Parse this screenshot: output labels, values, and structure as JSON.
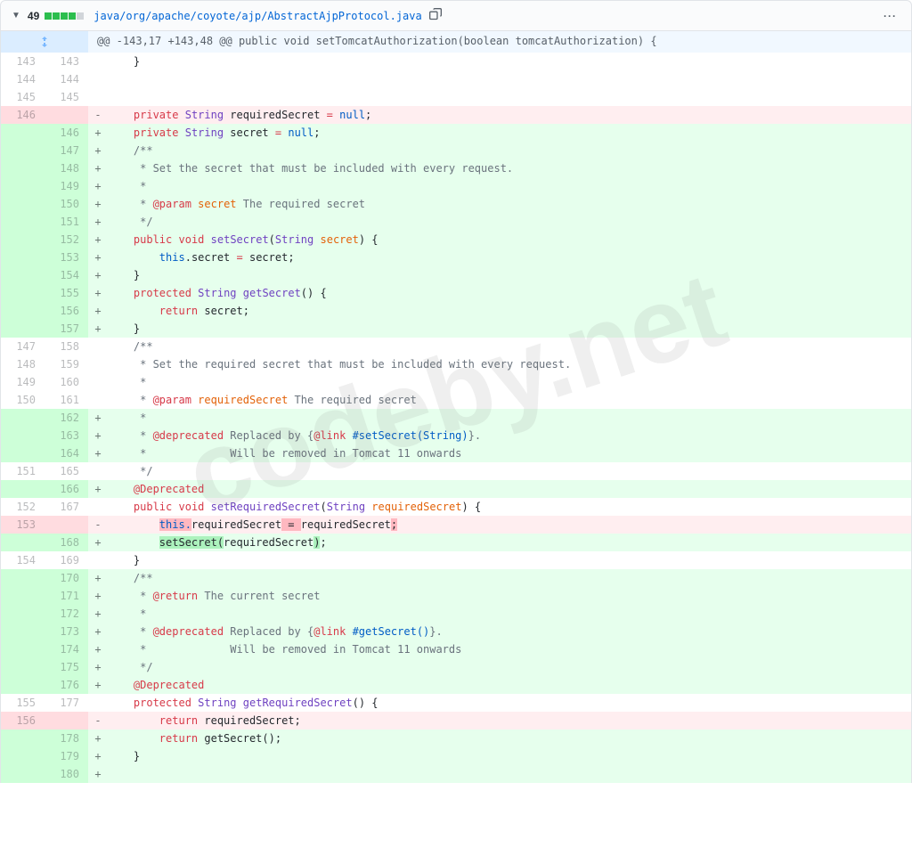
{
  "file": {
    "changes_count": "49",
    "diffstat_added": 4,
    "diffstat_neutral": 1,
    "path": "java/org/apache/coyote/ajp/AbstractAjpProtocol.java"
  },
  "hunk_header": "@@ -143,17 +143,48 @@ public void setTomcatAuthorization(boolean tomcatAuthorization) {",
  "watermark": "codeby.net",
  "lines": [
    {
      "type": "ctx",
      "old": "143",
      "new": "143",
      "tokens": [
        {
          "t": "    }",
          "c": ""
        }
      ]
    },
    {
      "type": "ctx",
      "old": "144",
      "new": "144",
      "tokens": [
        {
          "t": "",
          "c": ""
        }
      ]
    },
    {
      "type": "ctx",
      "old": "145",
      "new": "145",
      "tokens": [
        {
          "t": "",
          "c": ""
        }
      ]
    },
    {
      "type": "del",
      "old": "146",
      "new": "",
      "tokens": [
        {
          "t": "    ",
          "c": ""
        },
        {
          "t": "private",
          "c": "k"
        },
        {
          "t": " ",
          "c": ""
        },
        {
          "t": "String",
          "c": "t"
        },
        {
          "t": " requiredSecret ",
          "c": ""
        },
        {
          "t": "=",
          "c": "k"
        },
        {
          "t": " ",
          "c": ""
        },
        {
          "t": "null",
          "c": "n"
        },
        {
          "t": ";",
          "c": ""
        }
      ]
    },
    {
      "type": "add",
      "old": "",
      "new": "146",
      "tokens": [
        {
          "t": "    ",
          "c": ""
        },
        {
          "t": "private",
          "c": "k"
        },
        {
          "t": " ",
          "c": ""
        },
        {
          "t": "String",
          "c": "t"
        },
        {
          "t": " secret ",
          "c": ""
        },
        {
          "t": "=",
          "c": "k"
        },
        {
          "t": " ",
          "c": ""
        },
        {
          "t": "null",
          "c": "n"
        },
        {
          "t": ";",
          "c": ""
        }
      ]
    },
    {
      "type": "add",
      "old": "",
      "new": "147",
      "tokens": [
        {
          "t": "    ",
          "c": ""
        },
        {
          "t": "/**",
          "c": "c"
        }
      ]
    },
    {
      "type": "add",
      "old": "",
      "new": "148",
      "tokens": [
        {
          "t": "     * Set the secret that must be included with every request.",
          "c": "c"
        }
      ]
    },
    {
      "type": "add",
      "old": "",
      "new": "149",
      "tokens": [
        {
          "t": "     *",
          "c": "c"
        }
      ]
    },
    {
      "type": "add",
      "old": "",
      "new": "150",
      "tokens": [
        {
          "t": "     * ",
          "c": "c"
        },
        {
          "t": "@param",
          "c": "k"
        },
        {
          "t": " ",
          "c": "c"
        },
        {
          "t": "secret",
          "c": "v"
        },
        {
          "t": " The required secret",
          "c": "c"
        }
      ]
    },
    {
      "type": "add",
      "old": "",
      "new": "151",
      "tokens": [
        {
          "t": "     */",
          "c": "c"
        }
      ]
    },
    {
      "type": "add",
      "old": "",
      "new": "152",
      "tokens": [
        {
          "t": "    ",
          "c": ""
        },
        {
          "t": "public",
          "c": "k"
        },
        {
          "t": " ",
          "c": ""
        },
        {
          "t": "void",
          "c": "k"
        },
        {
          "t": " ",
          "c": ""
        },
        {
          "t": "setSecret",
          "c": "t"
        },
        {
          "t": "(",
          "c": ""
        },
        {
          "t": "String",
          "c": "t"
        },
        {
          "t": " ",
          "c": ""
        },
        {
          "t": "secret",
          "c": "v"
        },
        {
          "t": ") {",
          "c": ""
        }
      ]
    },
    {
      "type": "add",
      "old": "",
      "new": "153",
      "tokens": [
        {
          "t": "        ",
          "c": ""
        },
        {
          "t": "this",
          "c": "n"
        },
        {
          "t": ".",
          "c": ""
        },
        {
          "t": "secret ",
          "c": ""
        },
        {
          "t": "=",
          "c": "k"
        },
        {
          "t": " secret;",
          "c": ""
        }
      ]
    },
    {
      "type": "add",
      "old": "",
      "new": "154",
      "tokens": [
        {
          "t": "    }",
          "c": ""
        }
      ]
    },
    {
      "type": "add",
      "old": "",
      "new": "155",
      "tokens": [
        {
          "t": "    ",
          "c": ""
        },
        {
          "t": "protected",
          "c": "k"
        },
        {
          "t": " ",
          "c": ""
        },
        {
          "t": "String",
          "c": "t"
        },
        {
          "t": " ",
          "c": ""
        },
        {
          "t": "getSecret",
          "c": "t"
        },
        {
          "t": "() {",
          "c": ""
        }
      ]
    },
    {
      "type": "add",
      "old": "",
      "new": "156",
      "tokens": [
        {
          "t": "        ",
          "c": ""
        },
        {
          "t": "return",
          "c": "k"
        },
        {
          "t": " secret;",
          "c": ""
        }
      ]
    },
    {
      "type": "add",
      "old": "",
      "new": "157",
      "tokens": [
        {
          "t": "    }",
          "c": ""
        }
      ]
    },
    {
      "type": "ctx",
      "old": "147",
      "new": "158",
      "tokens": [
        {
          "t": "    ",
          "c": ""
        },
        {
          "t": "/**",
          "c": "c"
        }
      ]
    },
    {
      "type": "ctx",
      "old": "148",
      "new": "159",
      "tokens": [
        {
          "t": "     * Set the required secret that must be included with every request.",
          "c": "c"
        }
      ]
    },
    {
      "type": "ctx",
      "old": "149",
      "new": "160",
      "tokens": [
        {
          "t": "     *",
          "c": "c"
        }
      ]
    },
    {
      "type": "ctx",
      "old": "150",
      "new": "161",
      "tokens": [
        {
          "t": "     * ",
          "c": "c"
        },
        {
          "t": "@param",
          "c": "k"
        },
        {
          "t": " ",
          "c": "c"
        },
        {
          "t": "requiredSecret",
          "c": "v"
        },
        {
          "t": " The required secret",
          "c": "c"
        }
      ]
    },
    {
      "type": "add",
      "old": "",
      "new": "162",
      "tokens": [
        {
          "t": "     *",
          "c": "c"
        }
      ]
    },
    {
      "type": "add",
      "old": "",
      "new": "163",
      "tokens": [
        {
          "t": "     * ",
          "c": "c"
        },
        {
          "t": "@deprecated",
          "c": "k"
        },
        {
          "t": " Replaced by {",
          "c": "c"
        },
        {
          "t": "@link",
          "c": "k"
        },
        {
          "t": " ",
          "c": "c"
        },
        {
          "t": "#setSecret(String)",
          "c": "n"
        },
        {
          "t": "}.",
          "c": "c"
        }
      ]
    },
    {
      "type": "add",
      "old": "",
      "new": "164",
      "tokens": [
        {
          "t": "     *             Will be removed in Tomcat 11 onwards",
          "c": "c"
        }
      ]
    },
    {
      "type": "ctx",
      "old": "151",
      "new": "165",
      "tokens": [
        {
          "t": "     */",
          "c": "c"
        }
      ]
    },
    {
      "type": "add",
      "old": "",
      "new": "166",
      "tokens": [
        {
          "t": "    ",
          "c": ""
        },
        {
          "t": "@Deprecated",
          "c": "k"
        }
      ]
    },
    {
      "type": "ctx",
      "old": "152",
      "new": "167",
      "tokens": [
        {
          "t": "    ",
          "c": ""
        },
        {
          "t": "public",
          "c": "k"
        },
        {
          "t": " ",
          "c": ""
        },
        {
          "t": "void",
          "c": "k"
        },
        {
          "t": " ",
          "c": ""
        },
        {
          "t": "setRequiredSecret",
          "c": "t"
        },
        {
          "t": "(",
          "c": ""
        },
        {
          "t": "String",
          "c": "t"
        },
        {
          "t": " ",
          "c": ""
        },
        {
          "t": "requiredSecret",
          "c": "v"
        },
        {
          "t": ") {",
          "c": ""
        }
      ]
    },
    {
      "type": "del",
      "old": "153",
      "new": "",
      "tokens": [
        {
          "t": "        ",
          "c": ""
        },
        {
          "t": "this.",
          "c": "hl-del n"
        },
        {
          "t": "requiredSecret",
          "c": ""
        },
        {
          "t": " = ",
          "c": "hl-del"
        },
        {
          "t": "requiredSecret",
          "c": ""
        },
        {
          "t": ";",
          "c": "hl-del"
        }
      ]
    },
    {
      "type": "add",
      "old": "",
      "new": "168",
      "tokens": [
        {
          "t": "        ",
          "c": ""
        },
        {
          "t": "setSecret(",
          "c": "hl-add"
        },
        {
          "t": "requiredSecret",
          "c": ""
        },
        {
          "t": ")",
          "c": "hl-add"
        },
        {
          "t": ";",
          "c": ""
        }
      ]
    },
    {
      "type": "ctx",
      "old": "154",
      "new": "169",
      "tokens": [
        {
          "t": "    }",
          "c": ""
        }
      ]
    },
    {
      "type": "add",
      "old": "",
      "new": "170",
      "tokens": [
        {
          "t": "    ",
          "c": ""
        },
        {
          "t": "/**",
          "c": "c"
        }
      ]
    },
    {
      "type": "add",
      "old": "",
      "new": "171",
      "tokens": [
        {
          "t": "     * ",
          "c": "c"
        },
        {
          "t": "@return",
          "c": "k"
        },
        {
          "t": " The current secret",
          "c": "c"
        }
      ]
    },
    {
      "type": "add",
      "old": "",
      "new": "172",
      "tokens": [
        {
          "t": "     *",
          "c": "c"
        }
      ]
    },
    {
      "type": "add",
      "old": "",
      "new": "173",
      "tokens": [
        {
          "t": "     * ",
          "c": "c"
        },
        {
          "t": "@deprecated",
          "c": "k"
        },
        {
          "t": " Replaced by {",
          "c": "c"
        },
        {
          "t": "@link",
          "c": "k"
        },
        {
          "t": " ",
          "c": "c"
        },
        {
          "t": "#getSecret()",
          "c": "n"
        },
        {
          "t": "}.",
          "c": "c"
        }
      ]
    },
    {
      "type": "add",
      "old": "",
      "new": "174",
      "tokens": [
        {
          "t": "     *             Will be removed in Tomcat 11 onwards",
          "c": "c"
        }
      ]
    },
    {
      "type": "add",
      "old": "",
      "new": "175",
      "tokens": [
        {
          "t": "     */",
          "c": "c"
        }
      ]
    },
    {
      "type": "add",
      "old": "",
      "new": "176",
      "tokens": [
        {
          "t": "    ",
          "c": ""
        },
        {
          "t": "@Deprecated",
          "c": "k"
        }
      ]
    },
    {
      "type": "ctx",
      "old": "155",
      "new": "177",
      "tokens": [
        {
          "t": "    ",
          "c": ""
        },
        {
          "t": "protected",
          "c": "k"
        },
        {
          "t": " ",
          "c": ""
        },
        {
          "t": "String",
          "c": "t"
        },
        {
          "t": " ",
          "c": ""
        },
        {
          "t": "getRequiredSecret",
          "c": "t"
        },
        {
          "t": "() {",
          "c": ""
        }
      ]
    },
    {
      "type": "del",
      "old": "156",
      "new": "",
      "tokens": [
        {
          "t": "        ",
          "c": ""
        },
        {
          "t": "return",
          "c": "k"
        },
        {
          "t": " requiredSecret;",
          "c": ""
        }
      ]
    },
    {
      "type": "add",
      "old": "",
      "new": "178",
      "tokens": [
        {
          "t": "        ",
          "c": ""
        },
        {
          "t": "return",
          "c": "k"
        },
        {
          "t": " getSecret();",
          "c": ""
        }
      ]
    },
    {
      "type": "add",
      "old": "",
      "new": "179",
      "tokens": [
        {
          "t": "    }",
          "c": ""
        }
      ]
    },
    {
      "type": "add",
      "old": "",
      "new": "180",
      "tokens": [
        {
          "t": "",
          "c": ""
        }
      ]
    }
  ]
}
